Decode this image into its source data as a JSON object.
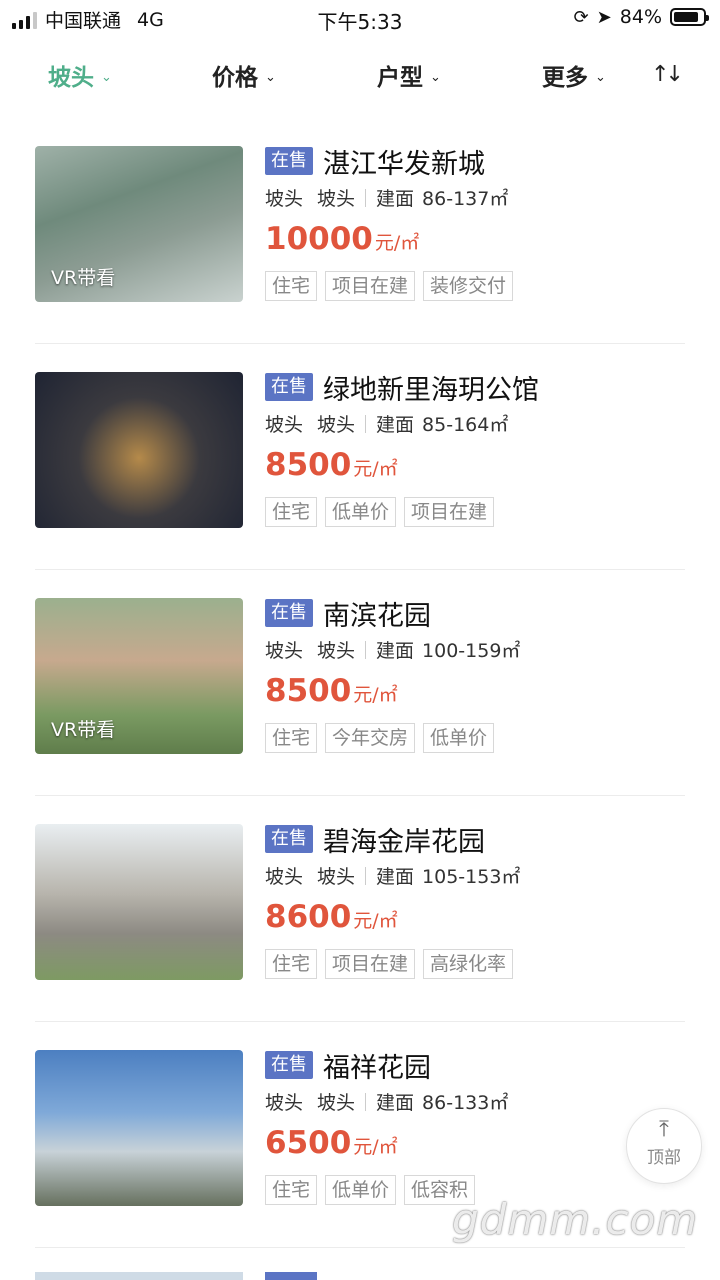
{
  "status_bar": {
    "carrier": "中国联通",
    "network": "4G",
    "time": "下午5:33",
    "battery": "84%",
    "battery_level": 0.84
  },
  "filters": [
    {
      "label": "坡头",
      "active": true
    },
    {
      "label": "价格",
      "active": false
    },
    {
      "label": "户型",
      "active": false
    },
    {
      "label": "更多",
      "active": false
    }
  ],
  "sort_icon": "sort-icon",
  "listings": [
    {
      "status": "在售",
      "name": "湛江华发新城",
      "district": "坡头",
      "area": "坡头",
      "area_label": "建面",
      "size": "86-137㎡",
      "price": "10000",
      "unit": "元/㎡",
      "tags": [
        "住宅",
        "项目在建",
        "装修交付"
      ],
      "vr": "VR带看",
      "image": "aerial-city"
    },
    {
      "status": "在售",
      "name": "绿地新里海玥公馆",
      "district": "坡头",
      "area": "坡头",
      "area_label": "建面",
      "size": "85-164㎡",
      "price": "8500",
      "unit": "元/㎡",
      "tags": [
        "住宅",
        "低单价",
        "项目在建"
      ],
      "vr": "",
      "image": "night-aerial"
    },
    {
      "status": "在售",
      "name": "南滨花园",
      "district": "坡头",
      "area": "坡头",
      "area_label": "建面",
      "size": "100-159㎡",
      "price": "8500",
      "unit": "元/㎡",
      "tags": [
        "住宅",
        "今年交房",
        "低单价"
      ],
      "vr": "VR带看",
      "image": "towers-green"
    },
    {
      "status": "在售",
      "name": "碧海金岸花园",
      "district": "坡头",
      "area": "坡头",
      "area_label": "建面",
      "size": "105-153㎡",
      "price": "8600",
      "unit": "元/㎡",
      "tags": [
        "住宅",
        "项目在建",
        "高绿化率"
      ],
      "vr": "",
      "image": "towers-day"
    },
    {
      "status": "在售",
      "name": "福祥花园",
      "district": "坡头",
      "area": "坡头",
      "area_label": "建面",
      "size": "86-133㎡",
      "price": "6500",
      "unit": "元/㎡",
      "tags": [
        "住宅",
        "低单价",
        "低容积"
      ],
      "vr": "",
      "image": "street-view"
    }
  ],
  "top_button": {
    "label": "顶部"
  },
  "watermark": "gdmm.com",
  "colors": {
    "accent": "#4fae8a",
    "price": "#e0553c",
    "badge": "#5b74c4"
  }
}
